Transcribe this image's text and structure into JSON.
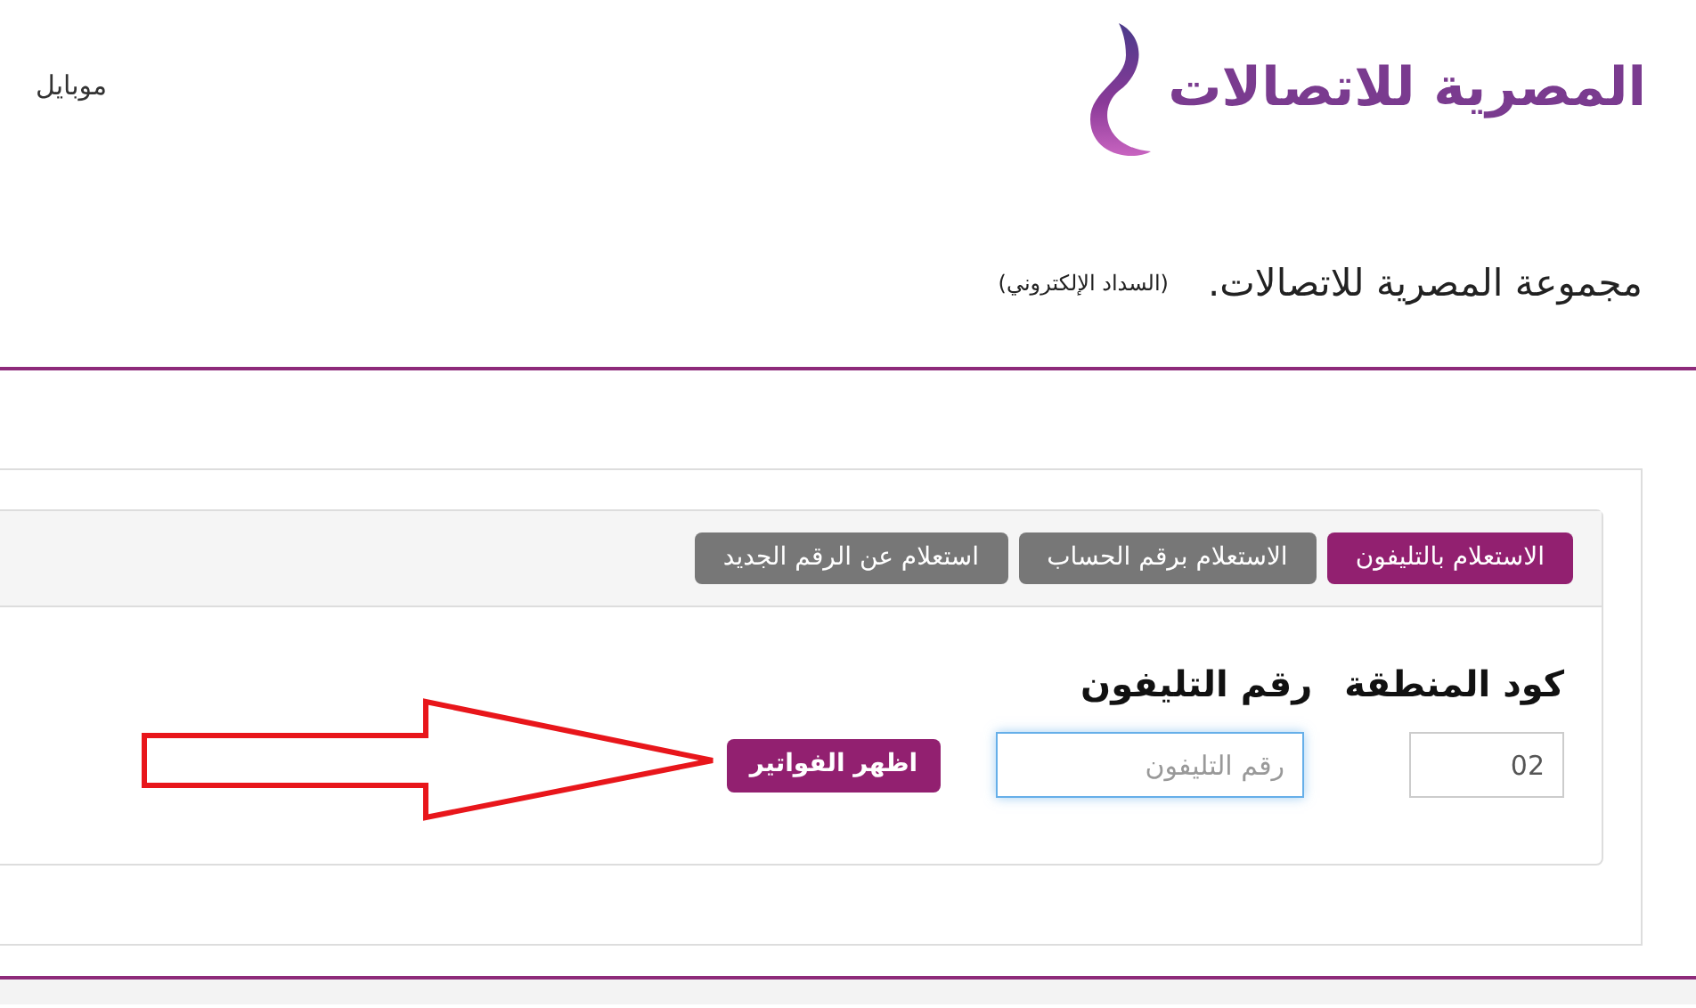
{
  "header": {
    "logo_text": "المصرية للاتصالات",
    "nav_link": "موبايل"
  },
  "title": {
    "main": "مجموعة المصرية للاتصالات.",
    "sub": "(السداد الإلكتروني)"
  },
  "tabs": [
    {
      "label": "الاستعلام بالتليفون",
      "selected": true
    },
    {
      "label": "الاستعلام برقم الحساب",
      "selected": false
    },
    {
      "label": "استعلام عن الرقم الجديد",
      "selected": false
    }
  ],
  "form": {
    "area_code_label": "كود المنطقة",
    "area_code_value": "02",
    "phone_label": "رقم التليفون",
    "phone_placeholder": "رقم التليفون",
    "phone_focused": true,
    "submit": "اظهر الفواتير"
  }
}
